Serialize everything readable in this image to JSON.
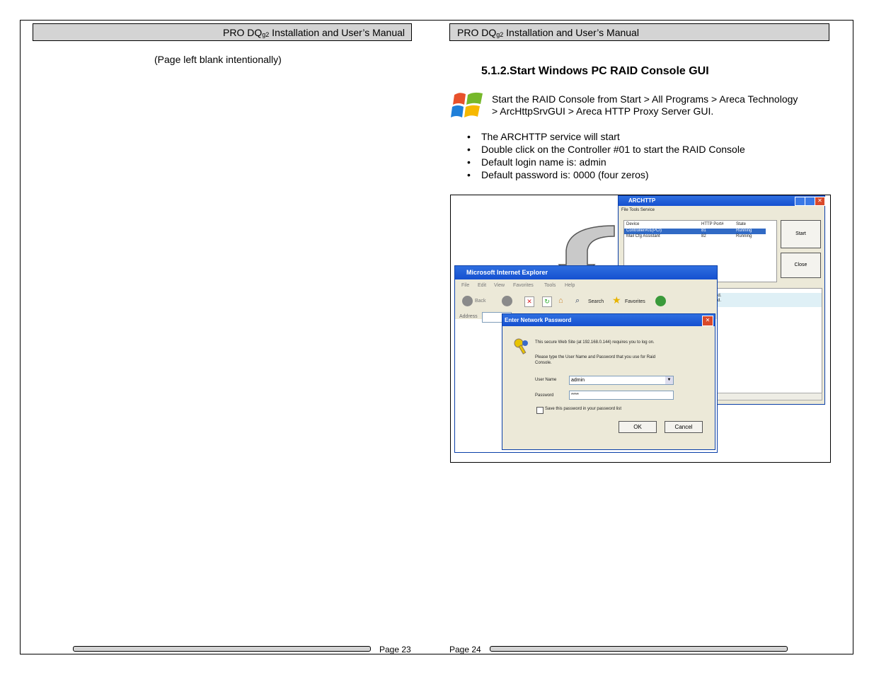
{
  "left_page": {
    "header": {
      "title_pre": "PRO DQ",
      "title_sub": "g2",
      "title_post": " Installation and User’s Manual"
    },
    "body_text": "(Page left blank intentionally)",
    "footer": {
      "page": "Page 23"
    }
  },
  "right_page": {
    "header": {
      "title_pre": "PRO DQ",
      "title_sub": "g2",
      "title_post": " Installation and User’s Manual"
    },
    "section_title": "5.1.2.Start Windows PC RAID Console GUI",
    "intro_line1": "Start the RAID Console from Start > All Programs > Areca Technology",
    "intro_line2": "> ArcHttpSrvGUI > Areca HTTP Proxy Server GUI.",
    "bullets": [
      "The ARCHTTP service will start",
      "Double click on the Controller #01 to start the RAID Console",
      "Default login name is: admin",
      "Default password is: 0000 (four zeros)"
    ],
    "screenshot": {
      "archttp": {
        "title": "ARCHTTP",
        "menu": "File  Tools  Service",
        "columns": [
          "Device",
          "HTTP Port#",
          "State"
        ],
        "rows": [
          [
            "Controller#01(PCI)",
            "81",
            "Running"
          ],
          [
            "Mail Cfg Assistant",
            "82",
            "Running"
          ]
        ],
        "start_btn": "Start",
        "close_btn": "Close",
        "log1": "arted.",
        "log2": "ound."
      },
      "ie": {
        "title": "Microsoft Internet Explorer",
        "menu": [
          "File",
          "Edit",
          "View",
          "Favorites",
          "Tools",
          "Help"
        ],
        "back": "Back",
        "search": "Search",
        "favorites": "Favorites",
        "address": "Address"
      },
      "dialog": {
        "title": "Enter Network Password",
        "line1": "This secure Web Site (at 192.168.0.144) requires you to log on.",
        "line2": "Please type the User Name and Password that you use for Raid",
        "line3": "Console.",
        "user_label": "User Name",
        "user_value": "admin",
        "pass_label": "Password",
        "pass_value": "****",
        "save_label": "Save this password in your password list",
        "ok": "OK",
        "cancel": "Cancel"
      }
    },
    "footer": {
      "page": "Page 24"
    }
  },
  "colors": {
    "header_gray": "#d4d4d4",
    "xp_blue": "#1550d0",
    "selection": "#316ac5"
  }
}
